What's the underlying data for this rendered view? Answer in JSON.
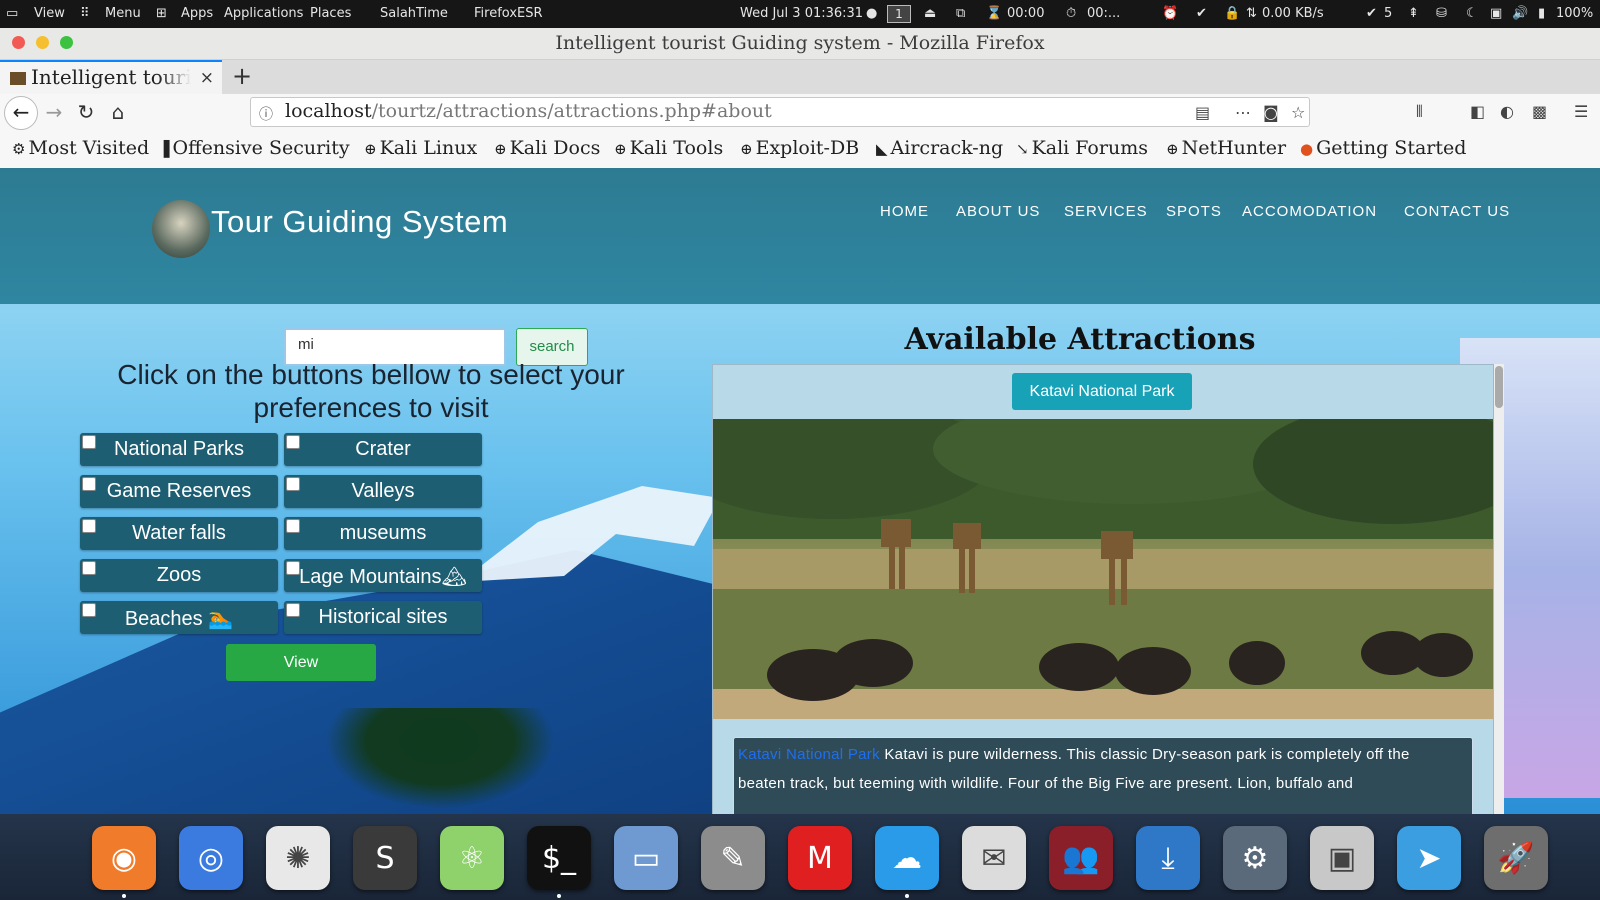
{
  "system_bar": {
    "view": "View",
    "menu": "Menu",
    "apps": "Apps",
    "applications": "Applications",
    "places": "Places",
    "salah_time": "SalahTime",
    "firefox_esr": "FirefoxESR",
    "datetime": "Wed Jul 3  01:36:31",
    "workspace": "1",
    "timer1": "00:00",
    "timer2": "00:...",
    "net_speed": "0.00 KB/s",
    "updates": "5",
    "battery": "100%"
  },
  "window": {
    "title": "Intelligent tourist Guiding system - Mozilla Firefox"
  },
  "tab": {
    "label": "Intelligent tourist Guiding system",
    "close": "×",
    "new_tab": "+"
  },
  "url": {
    "host": "localhost",
    "path": "/tourtz/attractions/attractions.php#about"
  },
  "bookmarks": [
    {
      "icon": "gear-icon",
      "glyph": "⚙",
      "label": "Most Visited"
    },
    {
      "icon": "offsec-icon",
      "glyph": "▐",
      "label": "Offensive Security"
    },
    {
      "icon": "globe-icon",
      "glyph": "⊕",
      "label": "Kali Linux"
    },
    {
      "icon": "globe-icon",
      "glyph": "⊕",
      "label": "Kali Docs"
    },
    {
      "icon": "globe-icon",
      "glyph": "⊕",
      "label": "Kali Tools"
    },
    {
      "icon": "globe-icon",
      "glyph": "⊕",
      "label": "Exploit-DB"
    },
    {
      "icon": "aircrack-icon",
      "glyph": "◣",
      "label": "Aircrack-ng"
    },
    {
      "icon": "kali-icon",
      "glyph": "↘",
      "label": "Kali Forums"
    },
    {
      "icon": "globe-icon",
      "glyph": "⊕",
      "label": "NetHunter"
    },
    {
      "icon": "firefox-icon",
      "glyph": "●",
      "label": "Getting Started"
    }
  ],
  "site": {
    "brand": "Tour Guiding System",
    "nav": [
      "HOME",
      "ABOUT US",
      "SERVICES",
      "SPOTS",
      "ACCOMODATION",
      "CONTACT US"
    ]
  },
  "search": {
    "value": "mi",
    "button": "search"
  },
  "preferences": {
    "prompt": "Click on the buttons bellow to select your preferences to visit",
    "options": [
      "National Parks",
      "Crater",
      "Game Reserves",
      "Valleys",
      "Water falls",
      "museums",
      "Zoos",
      "Lage Mountains🏔",
      "Beaches 🏊",
      "Historical sites"
    ],
    "view_button": "View"
  },
  "attractions": {
    "title": "Available Attractions",
    "park_button": "Katavi National Park",
    "desc_name": "Katavi National Park",
    "desc_line1": "Katavi is pure wilderness. This classic Dry-season park is completely off the",
    "desc_line2": "beaten track, but teeming with wildlife. Four of the Big Five are present. Lion, buffalo and"
  },
  "dock": [
    {
      "name": "firefox-dock-icon",
      "color": "#f07b2a",
      "glyph": "◉"
    },
    {
      "name": "chrome-dock-icon",
      "color": "#3b7be0",
      "glyph": "◎"
    },
    {
      "name": "maltego-dock-icon",
      "color": "#e8e8e8",
      "glyph": "✺"
    },
    {
      "name": "sublime-dock-icon",
      "color": "#3a3a3a",
      "glyph": "S"
    },
    {
      "name": "atom-dock-icon",
      "color": "#8fd16b",
      "glyph": "⚛"
    },
    {
      "name": "terminal-dock-icon",
      "color": "#111111",
      "glyph": "$_"
    },
    {
      "name": "files-dock-icon",
      "color": "#6f9ad1",
      "glyph": "▭"
    },
    {
      "name": "gimp-dock-icon",
      "color": "#8c8c8c",
      "glyph": "✎"
    },
    {
      "name": "gmail-dock-icon",
      "color": "#e02020",
      "glyph": "M"
    },
    {
      "name": "weather-dock-icon",
      "color": "#2a9be8",
      "glyph": "☁"
    },
    {
      "name": "mail-dock-icon",
      "color": "#dcdcdc",
      "glyph": "✉"
    },
    {
      "name": "contacts-dock-icon",
      "color": "#8a1f2a",
      "glyph": "👥"
    },
    {
      "name": "software-dock-icon",
      "color": "#2f78c8",
      "glyph": "⤓"
    },
    {
      "name": "settings-dock-icon",
      "color": "#5a6a7a",
      "glyph": "⚙"
    },
    {
      "name": "screenshot-dock-icon",
      "color": "#c8c8c8",
      "glyph": "▣"
    },
    {
      "name": "telegram-dock-icon",
      "color": "#3a9ee0",
      "glyph": "➤"
    },
    {
      "name": "launcher-dock-icon",
      "color": "#6e6e6e",
      "glyph": "🚀"
    }
  ]
}
